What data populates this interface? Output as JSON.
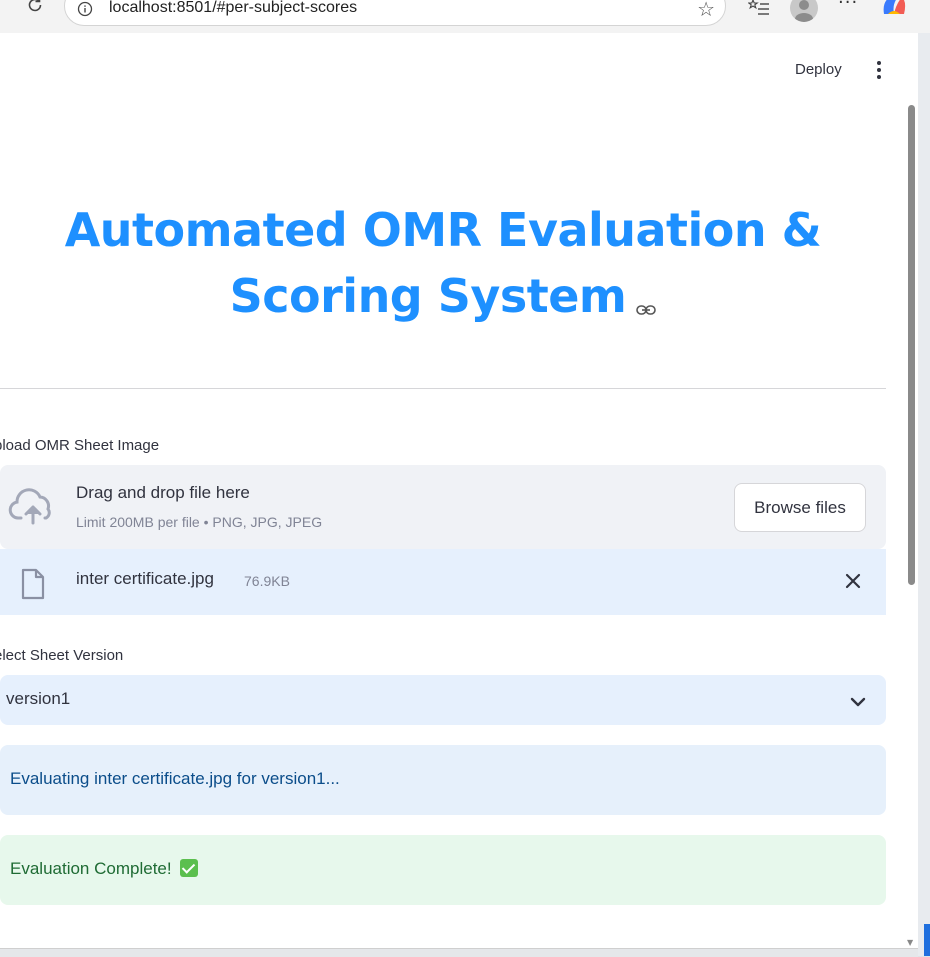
{
  "browser": {
    "url": "localhost:8501/#per-subject-scores",
    "more_label": "···"
  },
  "app": {
    "deploy_label": "Deploy",
    "title": "Automated OMR Evaluation & Scoring System"
  },
  "uploader": {
    "label": "pload OMR Sheet Image",
    "drop_title": "Drag and drop file here",
    "drop_subtitle": "Limit 200MB per file • PNG, JPG, JPEG",
    "browse_label": "Browse files",
    "file_name": "inter certificate.jpg",
    "file_size": "76.9KB"
  },
  "version_select": {
    "label": "elect Sheet Version",
    "value": "version1"
  },
  "alerts": {
    "info": "Evaluating inter certificate.jpg for version1...",
    "success": "Evaluation Complete!"
  },
  "colors": {
    "title": "#1e90ff",
    "info_bg": "#e6f0fb",
    "success_bg": "#e7f8ec"
  }
}
